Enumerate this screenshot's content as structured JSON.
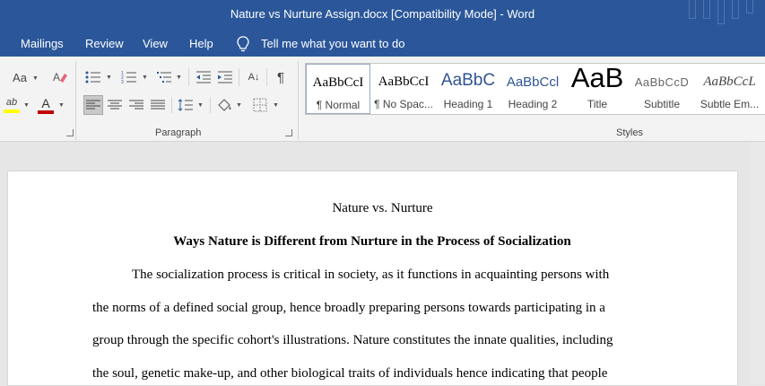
{
  "window": {
    "title": "Nature vs Nurture Assign.docx [Compatibility Mode]  -  Word"
  },
  "menu": {
    "tabs": [
      "Mailings",
      "Review",
      "View",
      "Help"
    ],
    "tell_me": "Tell me what you want to do"
  },
  "ribbon": {
    "font_controls": {
      "change_case": "Aa",
      "font_color": "A",
      "highlight": "ab"
    },
    "paragraph": {
      "label": "Paragraph",
      "pilcrow": "¶",
      "sort": "A↓"
    },
    "styles": {
      "label": "Styles",
      "items": [
        {
          "preview": "AaBbCcI",
          "name": "¶ Normal"
        },
        {
          "preview": "AaBbCcI",
          "name": "¶ No Spac..."
        },
        {
          "preview": "AaBbC",
          "name": "Heading 1"
        },
        {
          "preview": "AaBbCcl",
          "name": "Heading 2"
        },
        {
          "preview": "AaB",
          "name": "Title"
        },
        {
          "preview": "AaBbCcD",
          "name": "Subtitle"
        },
        {
          "preview": "AaBbCcL",
          "name": "Subtle Em..."
        }
      ]
    },
    "colors": {
      "accent": "#2b579a",
      "font_color_bar": "#c00000",
      "highlight_bar": "#ffff00",
      "heading_blue": "#2f5496"
    }
  },
  "document": {
    "title": "Nature vs. Nurture",
    "heading": "Ways Nature is Different from Nurture in the Process of Socialization",
    "lines": [
      "The socialization process is critical in society, as it functions in acquainting persons with",
      "the norms of a defined social group, hence broadly preparing persons towards participating in a",
      "group through the specific cohort's illustrations. Nature constitutes the innate qualities, including",
      "the soul, genetic make-up, and other biological traits of individuals hence indicating that people"
    ]
  }
}
